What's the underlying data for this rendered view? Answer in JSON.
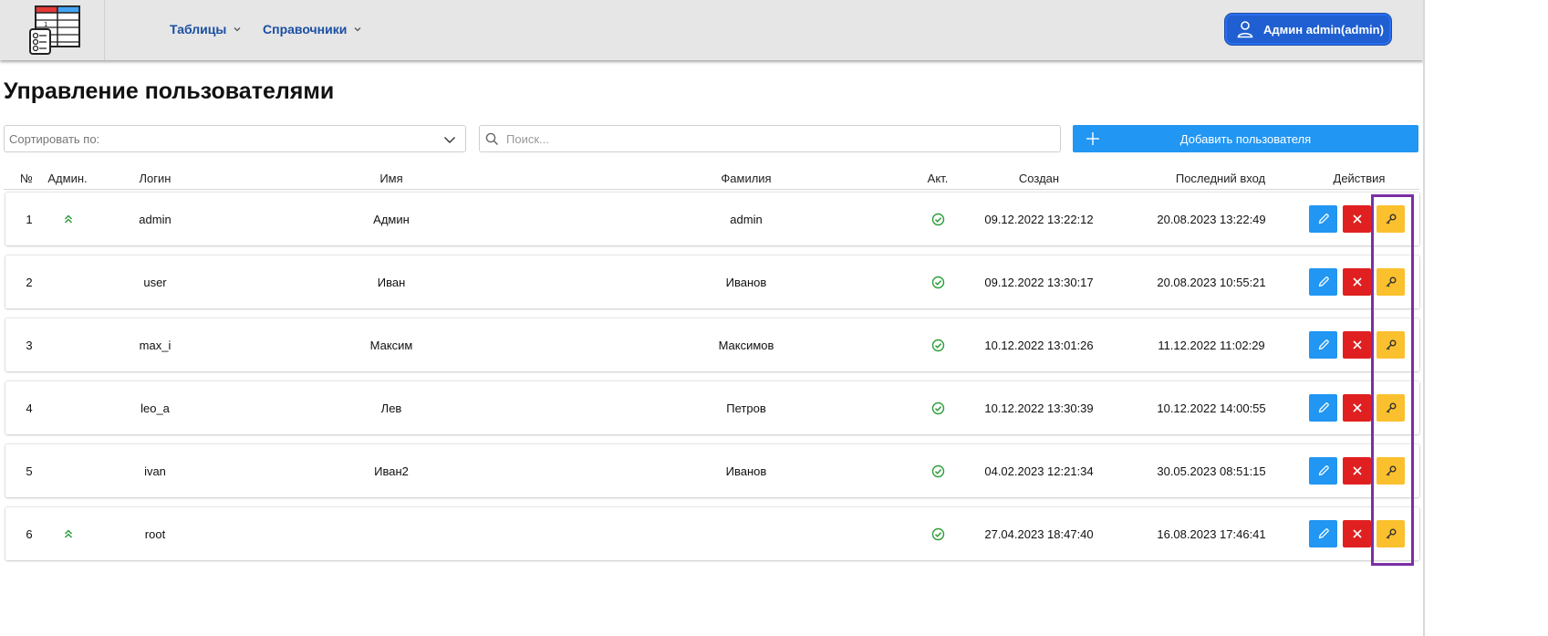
{
  "header": {
    "nav": [
      {
        "label": "Таблицы"
      },
      {
        "label": "Справочники"
      }
    ],
    "user_label": "Админ admin(admin)"
  },
  "page": {
    "title": "Управление пользователями"
  },
  "controls": {
    "sort_placeholder": "Сортировать по:",
    "search_placeholder": "Поиск...",
    "add_user_label": "Добавить пользователя"
  },
  "table": {
    "columns": [
      "№",
      "Админ.",
      "Логин",
      "Имя",
      "Фамилия",
      "Акт.",
      "Создан",
      "Последний вход",
      "Действия"
    ],
    "rows": [
      {
        "num": "1",
        "admin": true,
        "login": "admin",
        "first_name": "Админ",
        "last_name": "admin",
        "active": true,
        "created": "09.12.2022 13:22:12",
        "last_login": "20.08.2023 13:22:49"
      },
      {
        "num": "2",
        "admin": false,
        "login": "user",
        "first_name": "Иван",
        "last_name": "Иванов",
        "active": true,
        "created": "09.12.2022 13:30:17",
        "last_login": "20.08.2023 10:55:21"
      },
      {
        "num": "3",
        "admin": false,
        "login": "max_i",
        "first_name": "Максим",
        "last_name": "Максимов",
        "active": true,
        "created": "10.12.2022 13:01:26",
        "last_login": "11.12.2022 11:02:29"
      },
      {
        "num": "4",
        "admin": false,
        "login": "leo_a",
        "first_name": "Лев",
        "last_name": "Петров",
        "active": true,
        "created": "10.12.2022 13:30:39",
        "last_login": "10.12.2022 14:00:55"
      },
      {
        "num": "5",
        "admin": false,
        "login": "ivan",
        "first_name": "Иван2",
        "last_name": "Иванов",
        "active": true,
        "created": "04.02.2023 12:21:34",
        "last_login": "30.05.2023 08:51:15"
      },
      {
        "num": "6",
        "admin": true,
        "login": "root",
        "first_name": "",
        "last_name": "",
        "active": true,
        "created": "27.04.2023 18:47:40",
        "last_login": "16.08.2023 17:46:41"
      }
    ]
  },
  "colors": {
    "accent": "#2196f3",
    "delete": "#e02020",
    "key": "#fbc02d",
    "nav_text": "#1a4fa3",
    "user_button": "#1f5fd1",
    "active_check": "#2e9e3a",
    "admin_chevron": "#2e9e3a",
    "highlight": "#7b2fa6"
  },
  "icons": {
    "logo": "table-app-logo-icon",
    "user": "user-icon",
    "sort_dropdown": "chevron-down-icon",
    "search": "search-icon",
    "add": "plus-icon",
    "admin_flag": "double-chevron-up-icon",
    "active_flag": "check-circle-icon",
    "edit": "pencil-icon",
    "delete": "close-icon",
    "password": "key-icon"
  }
}
